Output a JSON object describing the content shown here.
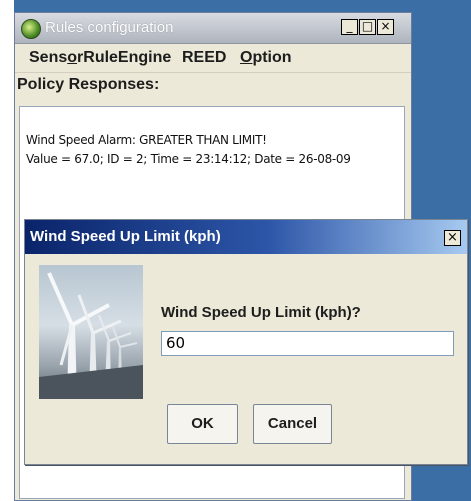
{
  "main_window": {
    "title": "Rules configuration",
    "controls": {
      "minimize": "_",
      "maximize": "□",
      "close": "×"
    },
    "menu": {
      "item1_pre": "Sens",
      "item1_mnemonic": "o",
      "item1_post": "rRuleEngine",
      "item2": "REED",
      "item3_mnemonic": "O",
      "item3_rest": "ption"
    },
    "policy_label": "Policy Responses:",
    "responses": [
      "Wind Speed Alarm: GREATER THAN LIMIT!",
      "Value = 67.0; ID = 2; Time = 23:14:12; Date = 26-08-09"
    ]
  },
  "dialog": {
    "title": "Wind Speed Up Limit (kph)",
    "close": "×",
    "prompt": "Wind Speed Up Limit (kph)?",
    "input_value": "60",
    "ok_label": "OK",
    "cancel_label": "Cancel",
    "image_icon": "wind-turbines"
  },
  "colors": {
    "desktop": "#3a6ea5",
    "dialog_title_start": "#0a246a",
    "dialog_title_end": "#a6caf0"
  }
}
